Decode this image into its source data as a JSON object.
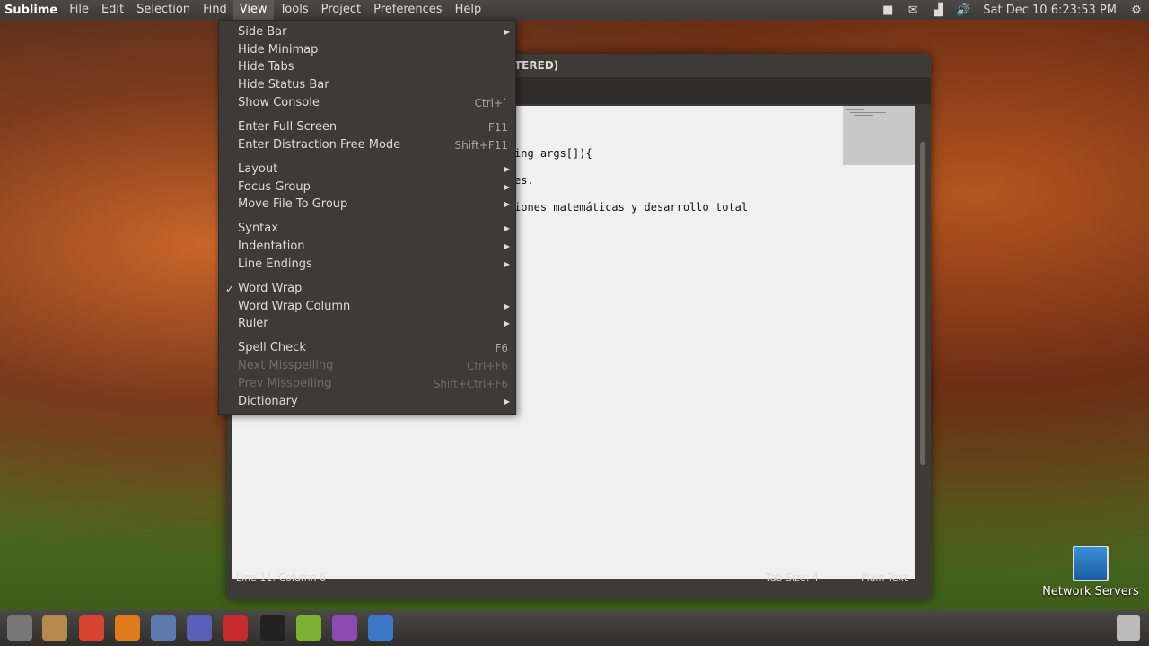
{
  "panel": {
    "app_name": "Sublime",
    "menus": [
      "File",
      "Edit",
      "Selection",
      "Find",
      "View",
      "Tools",
      "Project",
      "Preferences",
      "Help"
    ],
    "clock": "Sat Dec 10  6:23:53 PM"
  },
  "window": {
    "title_fragment": "TERED)",
    "code_lines": [
      "ing args[]){",
      "es.",
      "iones matemáticas y desarrollo total"
    ],
    "status": {
      "position": "Line 11, Column 6",
      "tab_size": "Tab Size: 4",
      "syntax": "Plain Text"
    }
  },
  "view_menu": {
    "items": [
      {
        "label": "Side Bar",
        "shortcut": "",
        "submenu": true,
        "disabled": false,
        "checked": false
      },
      {
        "label": "Hide Minimap",
        "shortcut": "",
        "submenu": false,
        "disabled": false,
        "checked": false
      },
      {
        "label": "Hide Tabs",
        "shortcut": "",
        "submenu": false,
        "disabled": false,
        "checked": false
      },
      {
        "label": "Hide Status Bar",
        "shortcut": "",
        "submenu": false,
        "disabled": false,
        "checked": false
      },
      {
        "label": "Show Console",
        "shortcut": "Ctrl+`",
        "submenu": false,
        "disabled": false,
        "checked": false
      },
      {
        "label": "Enter Full Screen",
        "shortcut": "F11",
        "submenu": false,
        "disabled": false,
        "checked": false
      },
      {
        "label": "Enter Distraction Free Mode",
        "shortcut": "Shift+F11",
        "submenu": false,
        "disabled": false,
        "checked": false
      },
      {
        "label": "Layout",
        "shortcut": "",
        "submenu": true,
        "disabled": false,
        "checked": false
      },
      {
        "label": "Focus Group",
        "shortcut": "",
        "submenu": true,
        "disabled": false,
        "checked": false
      },
      {
        "label": "Move File To Group",
        "shortcut": "",
        "submenu": true,
        "disabled": false,
        "checked": false
      },
      {
        "label": "Syntax",
        "shortcut": "",
        "submenu": true,
        "disabled": false,
        "checked": false
      },
      {
        "label": "Indentation",
        "shortcut": "",
        "submenu": true,
        "disabled": false,
        "checked": false
      },
      {
        "label": "Line Endings",
        "shortcut": "",
        "submenu": true,
        "disabled": false,
        "checked": false
      },
      {
        "label": "Word Wrap",
        "shortcut": "",
        "submenu": false,
        "disabled": false,
        "checked": true
      },
      {
        "label": "Word Wrap Column",
        "shortcut": "",
        "submenu": true,
        "disabled": false,
        "checked": false
      },
      {
        "label": "Ruler",
        "shortcut": "",
        "submenu": true,
        "disabled": false,
        "checked": false
      },
      {
        "label": "Spell Check",
        "shortcut": "F6",
        "submenu": false,
        "disabled": false,
        "checked": false
      },
      {
        "label": "Next Misspelling",
        "shortcut": "Ctrl+F6",
        "submenu": false,
        "disabled": true,
        "checked": false
      },
      {
        "label": "Prev Misspelling",
        "shortcut": "Shift+Ctrl+F6",
        "submenu": false,
        "disabled": true,
        "checked": false
      },
      {
        "label": "Dictionary",
        "shortcut": "",
        "submenu": true,
        "disabled": false,
        "checked": false
      }
    ]
  },
  "desktop": {
    "network_servers_label": "Network Servers"
  },
  "colors": {
    "panel_bg": "#3c3b37",
    "menu_text": "#dfdbd2",
    "editor_bg": "#f0f0f0"
  }
}
